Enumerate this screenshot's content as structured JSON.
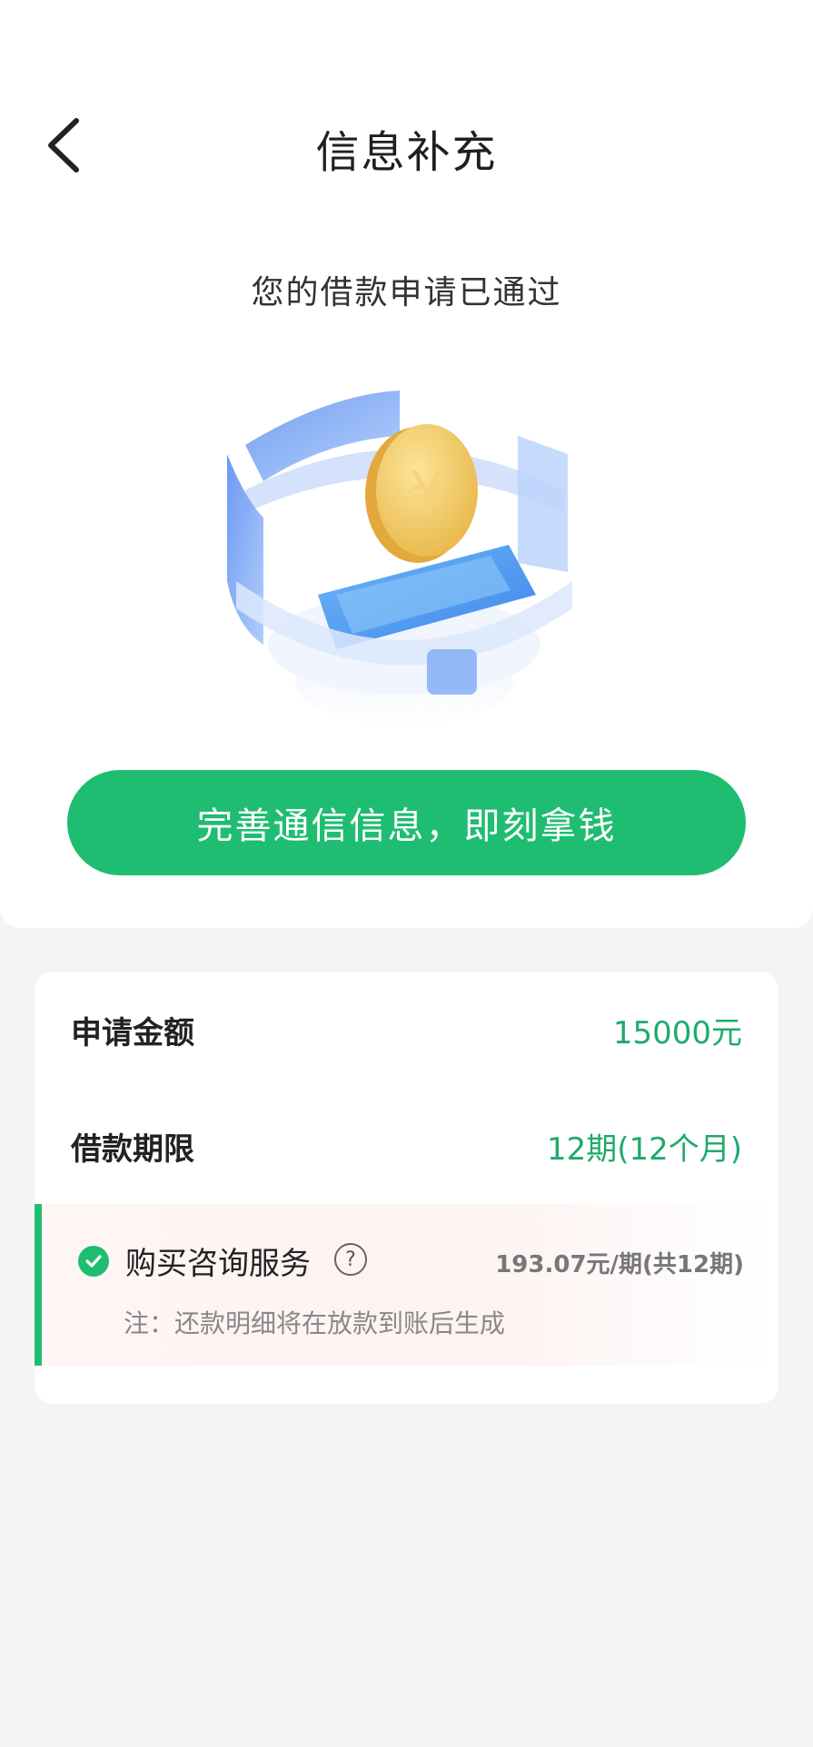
{
  "header": {
    "title": "信息补充",
    "back_icon": "chevron-left-icon"
  },
  "status": {
    "message": "您的借款申请已通过"
  },
  "cta": {
    "label": "完善通信信息，即刻拿钱",
    "color": "#1fbd72"
  },
  "details": {
    "rows": [
      {
        "label": "申请金额",
        "value": "15000元"
      },
      {
        "label": "借款期限",
        "value": "12期(12个月)"
      }
    ],
    "service": {
      "label": "购买咨询服务",
      "help_icon_text": "?",
      "price": "193.07元/期(共12期)",
      "note": "注：还款明细将在放款到账后生成",
      "checked": true
    }
  },
  "colors": {
    "accent": "#1fbd72",
    "value_text": "#1faa6b"
  }
}
